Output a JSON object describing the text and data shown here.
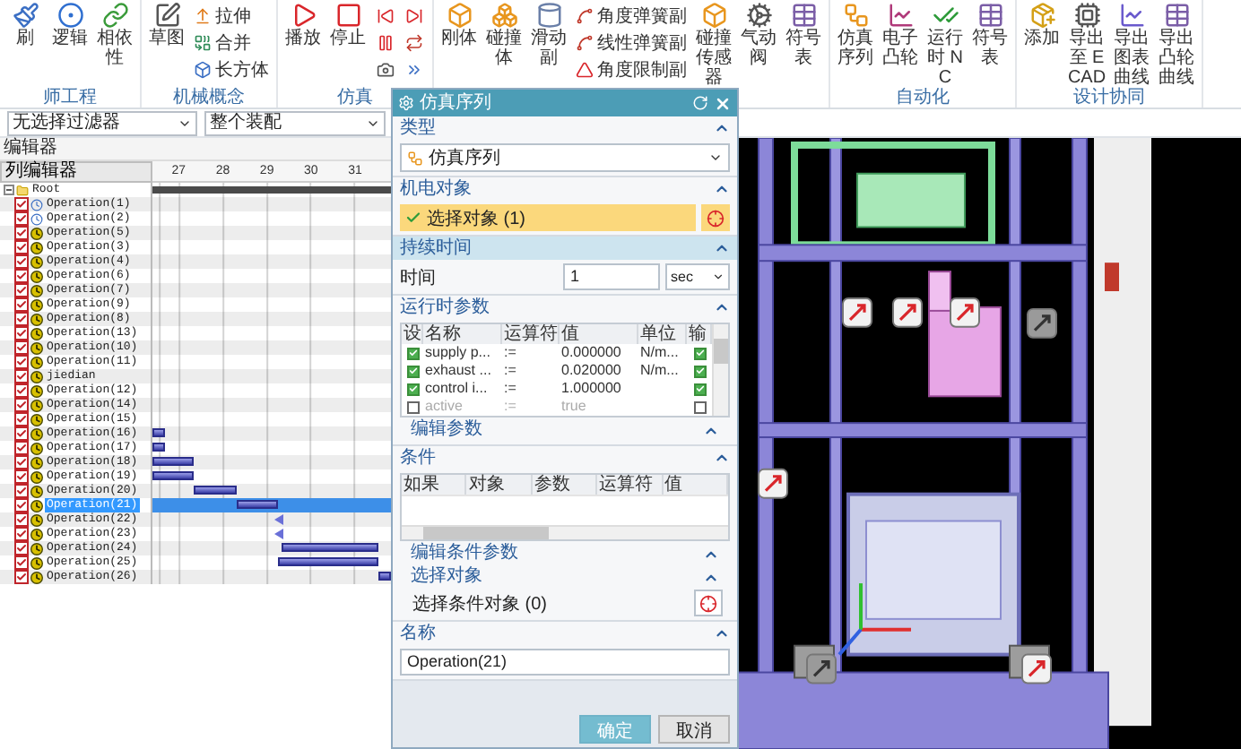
{
  "ribbon": {
    "groups": [
      {
        "label": "师工程",
        "items": [
          {
            "kind": "large",
            "label": "刷"
          },
          {
            "kind": "large",
            "label": "逻辑"
          },
          {
            "kind": "large",
            "label": "相依性"
          }
        ]
      },
      {
        "label": "机械概念",
        "items": [
          {
            "kind": "large",
            "label": "草图"
          },
          {
            "kind": "small",
            "label": "拉伸"
          },
          {
            "kind": "small",
            "label": "合并"
          },
          {
            "kind": "small",
            "label": "长方体"
          }
        ]
      },
      {
        "label": "仿真",
        "items": [
          {
            "kind": "large",
            "label": "播放"
          },
          {
            "kind": "large",
            "label": "停止"
          }
        ]
      },
      {
        "items": [
          {
            "kind": "large",
            "label": "刚体"
          },
          {
            "kind": "large",
            "label": "碰撞体"
          },
          {
            "kind": "large",
            "label": "滑动副"
          },
          {
            "kind": "small",
            "label": "角度弹簧副"
          },
          {
            "kind": "small",
            "label": "线性弹簧副"
          },
          {
            "kind": "small",
            "label": "角度限制副"
          },
          {
            "kind": "large",
            "label": "碰撞传感器"
          },
          {
            "kind": "large",
            "label": "气动阀"
          },
          {
            "kind": "large",
            "label": "符号表"
          }
        ]
      },
      {
        "label": "自动化",
        "items": [
          {
            "kind": "large",
            "label": "仿真序列"
          },
          {
            "kind": "large",
            "label": "电子凸轮"
          },
          {
            "kind": "large",
            "label": "运行时 NC"
          },
          {
            "kind": "large",
            "label": "符号表"
          }
        ]
      },
      {
        "label": "设计协同",
        "items": [
          {
            "kind": "large",
            "label": "添加"
          },
          {
            "kind": "large",
            "label": "导出至 ECAD"
          },
          {
            "kind": "large",
            "label": "导出图表曲线"
          },
          {
            "kind": "large",
            "label": "导出凸轮曲线"
          }
        ]
      }
    ]
  },
  "filter_bar": {
    "selects": [
      "无选择过滤器",
      "整个装配"
    ]
  },
  "sequence_editor": {
    "title": "编辑器",
    "column_header": "列编辑器",
    "ticks": [
      "27",
      "28",
      "29",
      "30",
      "31"
    ],
    "tree": {
      "label": "Root",
      "expanded": true,
      "children": [
        {
          "label": "Operation(1)",
          "kind": "timed",
          "checked": true,
          "selected": false
        },
        {
          "label": "Operation(2)",
          "kind": "timed",
          "checked": true,
          "selected": false
        },
        {
          "label": "Operation(5)",
          "kind": "event",
          "checked": true,
          "selected": false
        },
        {
          "label": "Operation(3)",
          "kind": "event",
          "checked": true,
          "selected": false
        },
        {
          "label": "Operation(4)",
          "kind": "event",
          "checked": true,
          "selected": false
        },
        {
          "label": "Operation(6)",
          "kind": "event",
          "checked": true,
          "selected": false
        },
        {
          "label": "Operation(7)",
          "kind": "event",
          "checked": true,
          "selected": false
        },
        {
          "label": "Operation(9)",
          "kind": "event",
          "checked": true,
          "selected": false
        },
        {
          "label": "Operation(8)",
          "kind": "event",
          "checked": true,
          "selected": false
        },
        {
          "label": "Operation(13)",
          "kind": "event",
          "checked": true,
          "selected": false
        },
        {
          "label": "Operation(10)",
          "kind": "event",
          "checked": true,
          "selected": false
        },
        {
          "label": "Operation(11)",
          "kind": "event",
          "checked": true,
          "selected": false
        },
        {
          "label": "jiedian",
          "kind": "event",
          "checked": true,
          "selected": false
        },
        {
          "label": "Operation(12)",
          "kind": "event",
          "checked": true,
          "selected": false
        },
        {
          "label": "Operation(14)",
          "kind": "event",
          "checked": true,
          "selected": false
        },
        {
          "label": "Operation(15)",
          "kind": "event",
          "checked": true,
          "selected": false
        },
        {
          "label": "Operation(16)",
          "kind": "event",
          "checked": true,
          "selected": false
        },
        {
          "label": "Operation(17)",
          "kind": "event",
          "checked": true,
          "selected": false
        },
        {
          "label": "Operation(18)",
          "kind": "event",
          "checked": true,
          "selected": false
        },
        {
          "label": "Operation(19)",
          "kind": "event",
          "checked": true,
          "selected": false
        },
        {
          "label": "Operation(20)",
          "kind": "event",
          "checked": true,
          "selected": false
        },
        {
          "label": "Operation(21)",
          "kind": "event",
          "checked": true,
          "selected": true
        },
        {
          "label": "Operation(22)",
          "kind": "event",
          "checked": true,
          "selected": false
        },
        {
          "label": "Operation(23)",
          "kind": "event",
          "checked": true,
          "selected": false
        },
        {
          "label": "Operation(24)",
          "kind": "event",
          "checked": true,
          "selected": false
        },
        {
          "label": "Operation(25)",
          "kind": "event",
          "checked": true,
          "selected": false
        },
        {
          "label": "Operation(26)",
          "kind": "event",
          "checked": true,
          "selected": false
        }
      ]
    }
  },
  "dialog": {
    "title": "仿真序列",
    "sections": [
      {
        "kind": "type",
        "title": "类型",
        "expanded": true,
        "active": false,
        "value": "仿真序列"
      },
      {
        "kind": "selection",
        "title": "机电对象",
        "expanded": true,
        "active": false,
        "selection": "选择对象 (1)",
        "satisfied": true,
        "selected": true
      },
      {
        "kind": "duration",
        "title": "持续时间",
        "expanded": true,
        "active": true,
        "label": "时间",
        "value": "1",
        "unit": "sec"
      },
      {
        "kind": "params",
        "title": "运行时参数",
        "expanded": true,
        "active": false,
        "columns": [
          "设",
          "名称",
          "运算符",
          "值",
          "单位",
          "输"
        ],
        "rows": [
          {
            "set": true,
            "name": "supply p...",
            "operator": ":=",
            "value": "0.000000",
            "unit": "N/m...",
            "output": true,
            "disabled": false
          },
          {
            "set": true,
            "name": "exhaust ...",
            "operator": ":=",
            "value": "0.020000",
            "unit": "N/m...",
            "output": true,
            "disabled": false
          },
          {
            "set": true,
            "name": "control i...",
            "operator": ":=",
            "value": "1.000000",
            "output": true,
            "disabled": false
          },
          {
            "set": false,
            "name": "active",
            "operator": ":=",
            "value": "true",
            "output": false,
            "disabled": true
          }
        ],
        "subsection": {
          "title": "编辑参数",
          "expanded": true
        }
      },
      {
        "kind": "conditions",
        "title": "条件",
        "expanded": true,
        "active": false,
        "columns": [
          "如果",
          "对象",
          "参数",
          "运算符",
          "值"
        ],
        "edit_params": {
          "title": "编辑条件参数",
          "expanded": true
        },
        "select_object": {
          "title": "选择对象",
          "expanded": true,
          "selection": "选择条件对象 (0)",
          "satisfied": false,
          "selected": false
        }
      },
      {
        "kind": "name",
        "title": "名称",
        "expanded": true,
        "active": false,
        "value": "Operation(21)"
      }
    ],
    "buttons": [
      {
        "label": "确定",
        "kind": "primary"
      },
      {
        "label": "取消",
        "kind": "secondary"
      }
    ]
  }
}
